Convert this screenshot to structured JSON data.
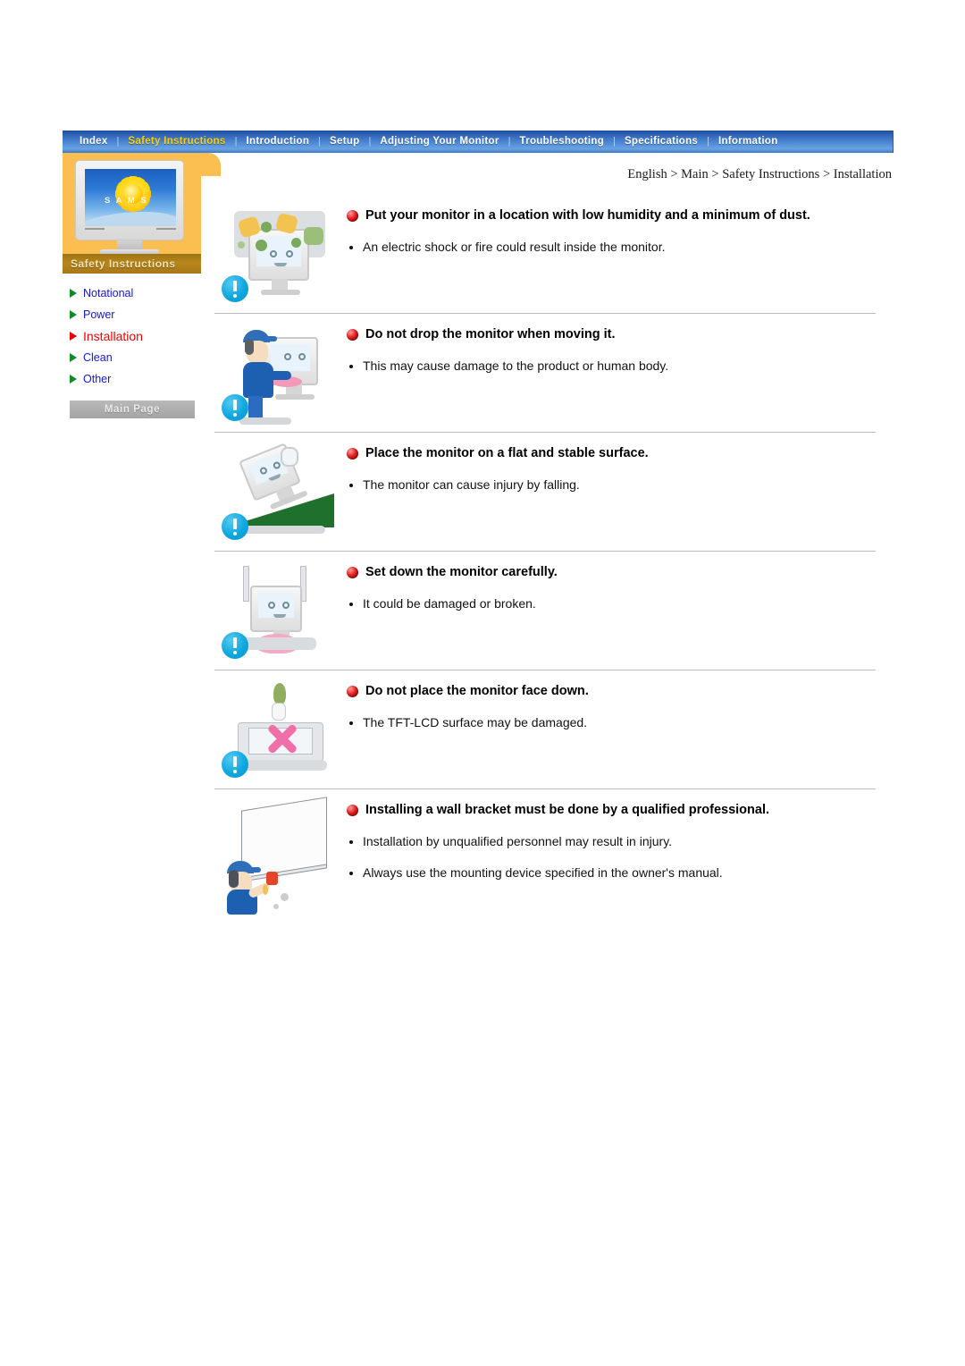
{
  "nav": {
    "items": [
      {
        "label": "Index",
        "active": false
      },
      {
        "label": "Safety Instructions",
        "active": true
      },
      {
        "label": "Introduction",
        "active": false
      },
      {
        "label": "Setup",
        "active": false
      },
      {
        "label": "Adjusting Your Monitor",
        "active": false
      },
      {
        "label": "Troubleshooting",
        "active": false
      },
      {
        "label": "Specifications",
        "active": false
      },
      {
        "label": "Information",
        "active": false
      }
    ],
    "separator": "|"
  },
  "sidebar": {
    "brand": {
      "caption": "Safety Instructions",
      "monitor_screen_text": "S A M S"
    },
    "items": [
      {
        "label": "Notational",
        "active": false
      },
      {
        "label": "Power",
        "active": false
      },
      {
        "label": "Installation",
        "active": true
      },
      {
        "label": "Clean",
        "active": false
      },
      {
        "label": "Other",
        "active": false
      }
    ],
    "main_page_button": "Main Page"
  },
  "breadcrumb": "English > Main > Safety Instructions > Installation",
  "sections": [
    {
      "heading": "Put your monitor in a location with low humidity and a minimum of dust.",
      "bullets": [
        "An electric shock or fire could result inside the monitor."
      ],
      "icon": "warning-exclamation-icon",
      "illustration": "monitor-with-dust-illustration"
    },
    {
      "heading": "Do not drop the monitor when moving it.",
      "bullets": [
        "This may cause damage to the product or human body."
      ],
      "icon": "warning-exclamation-icon",
      "illustration": "person-carrying-monitor-illustration"
    },
    {
      "heading": "Place the monitor on a flat and stable surface.",
      "bullets": [
        "The monitor can cause injury by falling."
      ],
      "icon": "warning-exclamation-icon",
      "illustration": "monitor-falling-off-slope-illustration"
    },
    {
      "heading": "Set down the monitor carefully.",
      "bullets": [
        "It could be damaged or broken."
      ],
      "icon": "warning-exclamation-icon",
      "illustration": "monitor-set-down-hard-illustration"
    },
    {
      "heading": "Do not place the monitor face down.",
      "bullets": [
        "The TFT-LCD surface may be damaged."
      ],
      "icon": "warning-exclamation-icon",
      "illustration": "monitor-face-down-crossed-illustration"
    },
    {
      "heading": "Installing a wall bracket must be done by a qualified professional.",
      "bullets": [
        "Installation by unqualified personnel may result in injury.",
        "Always use the mounting device specified in the owner's manual."
      ],
      "icon": "none",
      "illustration": "wall-bracket-installer-illustration"
    }
  ],
  "colors": {
    "nav_blue": "#2f63b4",
    "nav_active_yellow": "#ffd000",
    "sidebar_orange": "#fbbf51",
    "link_blue": "#1616d0",
    "active_red": "#f00000",
    "bullet_green": "#0f8a2a",
    "warning_cyan": "#0fa7e0",
    "ball_red": "#e21d1d"
  }
}
